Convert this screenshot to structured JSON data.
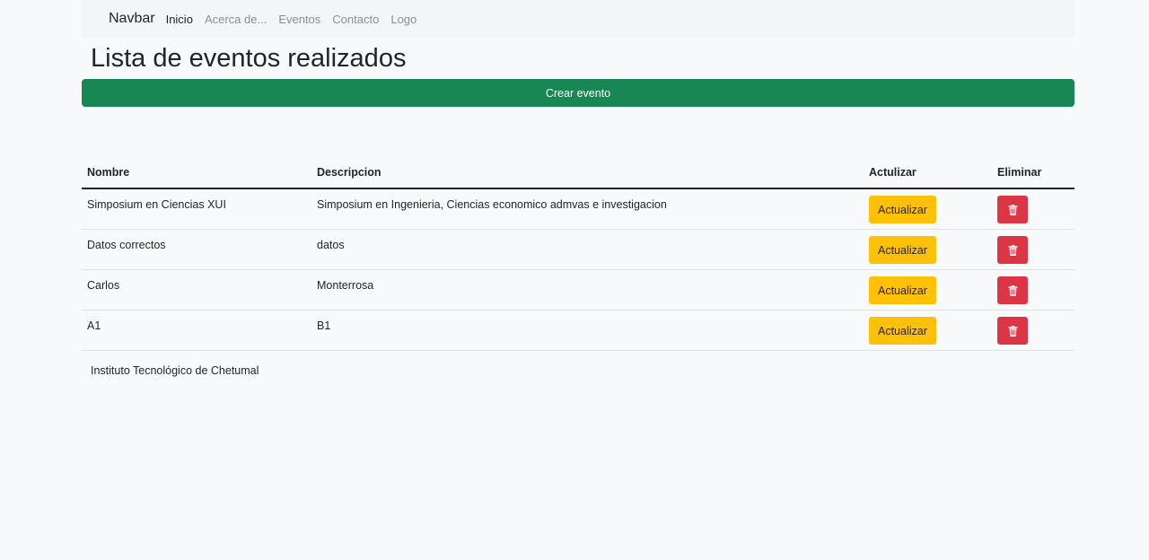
{
  "navbar": {
    "brand": "Navbar",
    "links": [
      "Inicio",
      "Acerca de...",
      "Eventos",
      "Contacto",
      "Logo"
    ]
  },
  "page": {
    "title": "Lista de eventos realizados",
    "create_button": "Crear evento"
  },
  "table": {
    "headers": [
      "Nombre",
      "Descripcion",
      "Actulizar",
      "Eliminar"
    ],
    "update_label": "Actualizar",
    "delete_icon": "trash-icon",
    "rows": [
      {
        "nombre": "Simposium en Ciencias XUI",
        "descripcion": "Simposium en Ingenieria, Ciencias economico admvas e investigacion"
      },
      {
        "nombre": "Datos correctos",
        "descripcion": "datos"
      },
      {
        "nombre": "Carlos",
        "descripcion": "Monterrosa"
      },
      {
        "nombre": "A1",
        "descripcion": "B1"
      }
    ]
  },
  "footer": {
    "text": "Instituto Tecnológico de Chetumal"
  },
  "colors": {
    "success": "#198754",
    "warning": "#ffc107",
    "danger": "#dc3545"
  }
}
